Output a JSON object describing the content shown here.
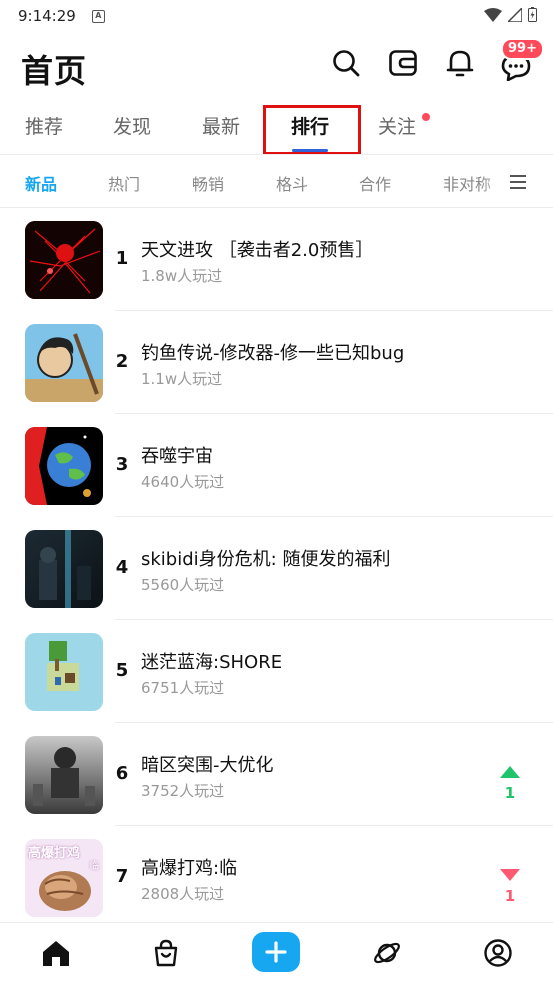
{
  "status_bar": {
    "time": "9:14:29",
    "notification_icon_letter": "A"
  },
  "header": {
    "title": "首页",
    "badge_count": "99+"
  },
  "main_tabs": [
    {
      "label": "推荐"
    },
    {
      "label": "发现"
    },
    {
      "label": "最新"
    },
    {
      "label": "排行",
      "active": true
    },
    {
      "label": "关注",
      "has_dot": true
    }
  ],
  "sub_tabs": [
    {
      "label": "新品",
      "active": true
    },
    {
      "label": "热门"
    },
    {
      "label": "畅销"
    },
    {
      "label": "格斗"
    },
    {
      "label": "合作"
    },
    {
      "label": "非对称"
    }
  ],
  "ranking": [
    {
      "rank": "1",
      "title": "天文进攻 ［袭击者2.0预售］",
      "plays": "1.8w人玩过"
    },
    {
      "rank": "2",
      "title": "钓鱼传说-修改器-修一些已知bug",
      "plays": "1.1w人玩过"
    },
    {
      "rank": "3",
      "title": "吞噬宇宙",
      "plays": "4640人玩过"
    },
    {
      "rank": "4",
      "title": "skibidi身份危机: 随便发的福利",
      "plays": "5560人玩过"
    },
    {
      "rank": "5",
      "title": "迷茫蓝海:SHORE",
      "plays": "6751人玩过"
    },
    {
      "rank": "6",
      "title": "暗区突围-大优化",
      "plays": "3752人玩过",
      "trend": "up",
      "trend_value": "1"
    },
    {
      "rank": "7",
      "title": "高爆打鸡:临",
      "plays": "2808人玩过",
      "trend": "down",
      "trend_value": "1",
      "thumb_text": "高爆打鸡",
      "thumb_text2": "临"
    }
  ],
  "colors": {
    "accent": "#16a7f0",
    "up": "#1fc46b",
    "down": "#ff5a72",
    "highlight": "#e01010",
    "badge": "#ff4a5a"
  },
  "icons": {
    "header": [
      "search-icon",
      "wallet-icon",
      "bell-icon",
      "message-icon"
    ],
    "nav": [
      "home-icon",
      "shop-bag-icon",
      "add-icon",
      "planet-icon",
      "profile-icon"
    ]
  }
}
